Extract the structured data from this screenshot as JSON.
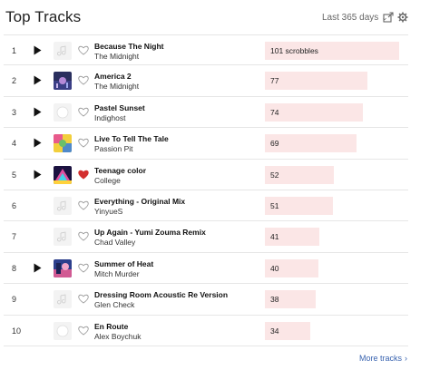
{
  "header": {
    "title": "Top Tracks",
    "period_label": "Last 365 days",
    "period_chevron": "⌄"
  },
  "max_scrobbles": 101,
  "tracks": [
    {
      "rank": "1",
      "title": "Because The Night",
      "artist": "The Midnight",
      "count": 101,
      "count_label": "101 scrobbles",
      "has_play": true,
      "loved": false,
      "art": "placeholder"
    },
    {
      "rank": "2",
      "title": "America 2",
      "artist": "The Midnight",
      "count": 77,
      "count_label": "77",
      "has_play": true,
      "loved": false,
      "art": "album-america2"
    },
    {
      "rank": "3",
      "title": "Pastel Sunset",
      "artist": "Indighost",
      "count": 74,
      "count_label": "74",
      "has_play": true,
      "loved": false,
      "art": "placeholder-circle"
    },
    {
      "rank": "4",
      "title": "Live To Tell The Tale",
      "artist": "Passion Pit",
      "count": 69,
      "count_label": "69",
      "has_play": true,
      "loved": false,
      "art": "album-passionpit"
    },
    {
      "rank": "5",
      "title": "Teenage color",
      "artist": "College",
      "count": 52,
      "count_label": "52",
      "has_play": true,
      "loved": true,
      "art": "album-college"
    },
    {
      "rank": "6",
      "title": "Everything - Original Mix",
      "artist": "YinyueS",
      "count": 51,
      "count_label": "51",
      "has_play": false,
      "loved": false,
      "art": "placeholder"
    },
    {
      "rank": "7",
      "title": "Up Again - Yumi Zouma Remix",
      "artist": "Chad Valley",
      "count": 41,
      "count_label": "41",
      "has_play": false,
      "loved": false,
      "art": "placeholder"
    },
    {
      "rank": "8",
      "title": "Summer of Heat",
      "artist": "Mitch Murder",
      "count": 40,
      "count_label": "40",
      "has_play": true,
      "loved": false,
      "art": "album-mitchmurder"
    },
    {
      "rank": "9",
      "title": "Dressing Room Acoustic Re Version",
      "artist": "Glen Check",
      "count": 38,
      "count_label": "38",
      "has_play": false,
      "loved": false,
      "art": "placeholder"
    },
    {
      "rank": "10",
      "title": "En Route",
      "artist": "Alex Boychuk",
      "count": 34,
      "count_label": "34",
      "has_play": false,
      "loved": false,
      "art": "placeholder-circle"
    }
  ],
  "footer": {
    "more_label": "More tracks",
    "more_chevron": "›"
  },
  "colors": {
    "bar_fill": "#fbe6e6",
    "loved_heart": "#d32f2f",
    "link": "#3a64b0"
  },
  "icons": [
    "play-icon",
    "heart-icon",
    "share-icon",
    "gear-icon",
    "chevron-down-icon",
    "music-note-icon"
  ]
}
